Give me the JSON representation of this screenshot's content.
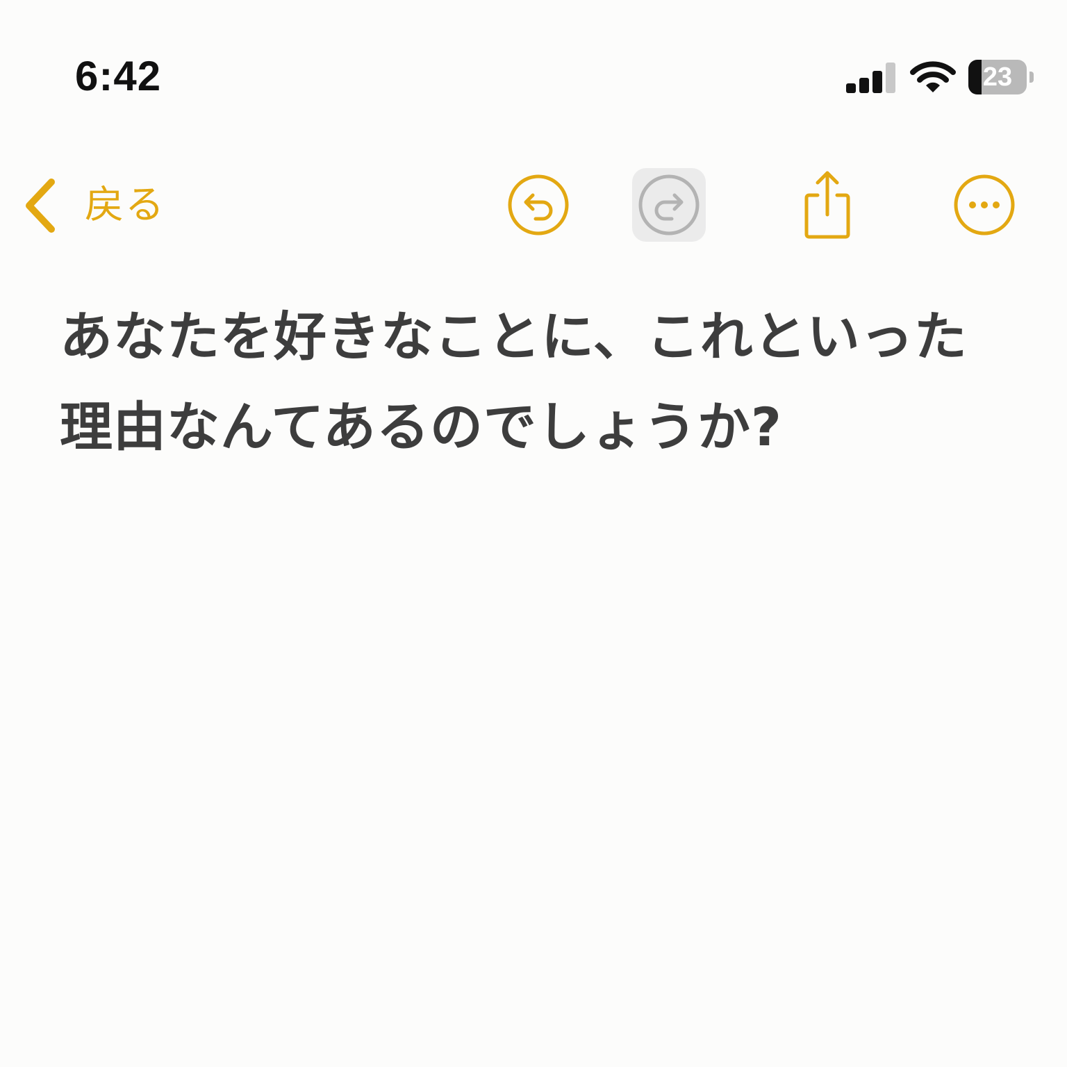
{
  "status_bar": {
    "time": "6:42",
    "battery_percent": "23",
    "battery_level": 0.23,
    "signal_bars_active": 3,
    "signal_bars_total": 4,
    "icons": [
      "signal-icon",
      "wifi-icon",
      "battery-icon"
    ]
  },
  "toolbar": {
    "back_label": "戻る",
    "icons": [
      "chevron-left-icon",
      "undo-icon",
      "redo-icon",
      "share-icon",
      "more-icon"
    ]
  },
  "note": {
    "lines": [
      "あなたを好きなことに、これといった",
      "理由なんてあるのでしょうか?"
    ]
  },
  "colors": {
    "accent": "#e3a812",
    "text": "#3d3d3d",
    "disabled": "#b3b3b3",
    "background": "#fcfcfb"
  }
}
